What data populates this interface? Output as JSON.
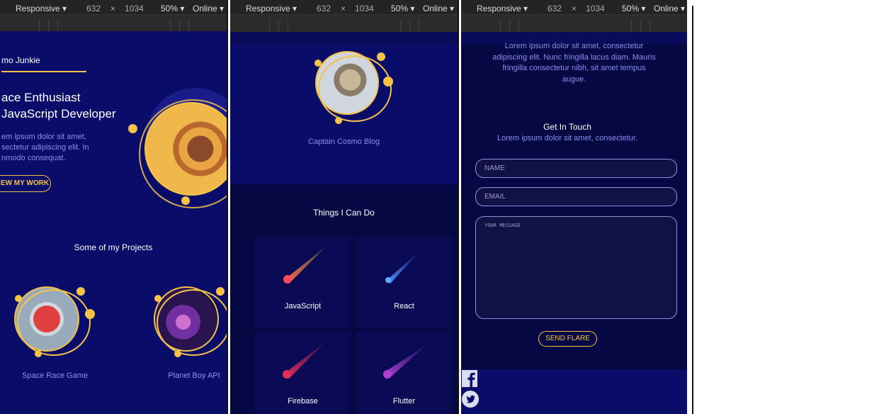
{
  "devtools": {
    "device": "Responsive",
    "width": "632",
    "times": "×",
    "height": "1034",
    "zoom": "50%",
    "network": "Online"
  },
  "panel1": {
    "brand": "mo Junkie",
    "headline_line1": "ace Enthusiast",
    "headline_line2": "JavaScript Developer",
    "intro_line1": "em ipsum dolor sit amet,",
    "intro_line2": "sectetur adipiscing elit. In",
    "intro_line3": "nmodo consequat.",
    "cta": "EW MY WORK",
    "projects_title": "Some of my Projects",
    "projects": [
      {
        "label": "Space Race Game"
      },
      {
        "label": "Planet Boy API"
      }
    ]
  },
  "panel2": {
    "blog_label": "Captain Cosmo Blog",
    "skills_title": "Things I Can Do",
    "skills": [
      {
        "label": "JavaScript"
      },
      {
        "label": "React"
      },
      {
        "label": "Firebase"
      },
      {
        "label": "Flutter"
      }
    ]
  },
  "panel3": {
    "about_line1": "Lorem ipsum dolor sit amet, consectetur",
    "about_line2": "adipiscing elit. Nunc fringilla lacus diam. Mauris",
    "about_line3": "fringilla consectetur nibh, sit amet tempus",
    "about_line4": "augue.",
    "contact_title": "Get In Touch",
    "contact_sub": "Lorem ipsum dolor sit amet, consectetur.",
    "name_placeholder": "NAME",
    "email_placeholder": "EMAIL",
    "message_placeholder": "YOUR MESSAGE",
    "send_button": "SEND FLARE"
  },
  "colors": {
    "accent": "#f6c34a",
    "page_bg": "#0a0c5a",
    "dark_bg": "#060844",
    "muted_text": "#8c8ff0"
  }
}
